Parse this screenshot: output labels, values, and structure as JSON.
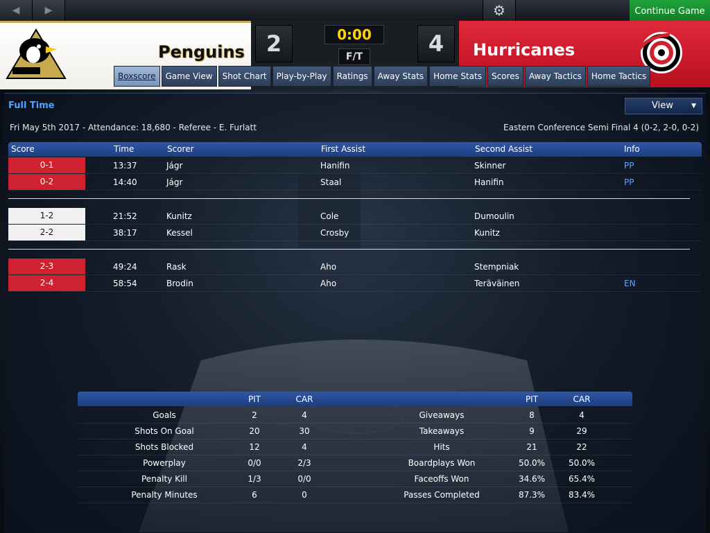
{
  "toolbar": {
    "back_icon": "chevron-left-icon",
    "forward_icon": "chevron-right-icon",
    "settings_icon": "gear-icon",
    "continue_label": "Continue Game"
  },
  "scoreboard": {
    "home_team": "Penguins",
    "away_team": "Hurricanes",
    "home_score": "2",
    "away_score": "4",
    "clock": "0:00",
    "period": "F/T",
    "colors": {
      "home_accent": "#c9a94d",
      "away_accent": "#cf2231",
      "clock": "#ffd400"
    }
  },
  "tabs": [
    "Boxscore",
    "Game View",
    "Shot Chart",
    "Play-by-Play",
    "Ratings",
    "Away Stats",
    "Home Stats",
    "Scores",
    "Away Tactics",
    "Home Tactics"
  ],
  "active_tab": "Boxscore",
  "summary": {
    "title": "Full Time",
    "view_label": "View",
    "game_info": "Fri May 5th 2017 - Attendance: 18,680 - Referee - E. Furlatt",
    "series_info": "Eastern Conference Semi Final 4 (0-2, 2-0, 0-2)"
  },
  "goals_table": {
    "headers": [
      "Score",
      "Time",
      "Scorer",
      "First Assist",
      "Second Assist",
      "Info"
    ],
    "rows": [
      {
        "score": "0-1",
        "time": "13:37",
        "scorer": "Jágr",
        "first": "Hanifin",
        "second": "Skinner",
        "info": "PP",
        "team": "away"
      },
      {
        "score": "0-2",
        "time": "14:40",
        "scorer": "Jágr",
        "first": "Staal",
        "second": "Hanifin",
        "info": "PP",
        "team": "away"
      },
      {
        "score": "1-2",
        "time": "21:52",
        "scorer": "Kunitz",
        "first": "Cole",
        "second": "Dumoulin",
        "info": "",
        "team": "home"
      },
      {
        "score": "2-2",
        "time": "38:17",
        "scorer": "Kessel",
        "first": "Crosby",
        "second": "Kunitz",
        "info": "",
        "team": "home"
      },
      {
        "score": "2-3",
        "time": "49:24",
        "scorer": "Rask",
        "first": "Aho",
        "second": "Stempniak",
        "info": "",
        "team": "away"
      },
      {
        "score": "2-4",
        "time": "58:54",
        "scorer": "Brodin",
        "first": "Aho",
        "second": "Teräväinen",
        "info": "EN",
        "team": "away"
      }
    ]
  },
  "stats_table": {
    "headers": {
      "pit": "PIT",
      "car": "CAR"
    },
    "left": [
      {
        "label": "Goals",
        "pit": "2",
        "car": "4"
      },
      {
        "label": "Shots On Goal",
        "pit": "20",
        "car": "30"
      },
      {
        "label": "Shots Blocked",
        "pit": "12",
        "car": "4"
      },
      {
        "label": "Powerplay",
        "pit": "0/0",
        "car": "2/3"
      },
      {
        "label": "Penalty Kill",
        "pit": "1/3",
        "car": "0/0"
      },
      {
        "label": "Penalty Minutes",
        "pit": "6",
        "car": "0"
      }
    ],
    "right": [
      {
        "label": "Giveaways",
        "pit": "8",
        "car": "4"
      },
      {
        "label": "Takeaways",
        "pit": "9",
        "car": "29"
      },
      {
        "label": "Hits",
        "pit": "21",
        "car": "22"
      },
      {
        "label": "Boardplays Won",
        "pit": "50.0%",
        "car": "50.0%"
      },
      {
        "label": "Faceoffs Won",
        "pit": "34.6%",
        "car": "65.4%"
      },
      {
        "label": "Passes Completed",
        "pit": "87.3%",
        "car": "83.4%"
      }
    ]
  }
}
